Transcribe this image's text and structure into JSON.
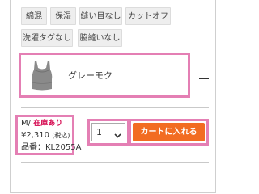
{
  "tags": [
    "綿混",
    "保湿",
    "縫い目なし",
    "カットオフ",
    "洗濯タグなし",
    "脇縫いなし"
  ],
  "variant": {
    "color_name": "グレーモク",
    "image_icon": "gray-tank-top-icon"
  },
  "product_info": {
    "size": "M/",
    "stock": "在庫あり",
    "price": "¥2,310",
    "tax_note": "(税込)",
    "sku": "品番：KL2055A"
  },
  "quantity": {
    "selected": "1"
  },
  "cart": {
    "button_label": "カートに入れる"
  },
  "colors": {
    "highlight": "#e47fb4",
    "cart_button": "#f26c22",
    "stock_text": "#d4004a"
  }
}
